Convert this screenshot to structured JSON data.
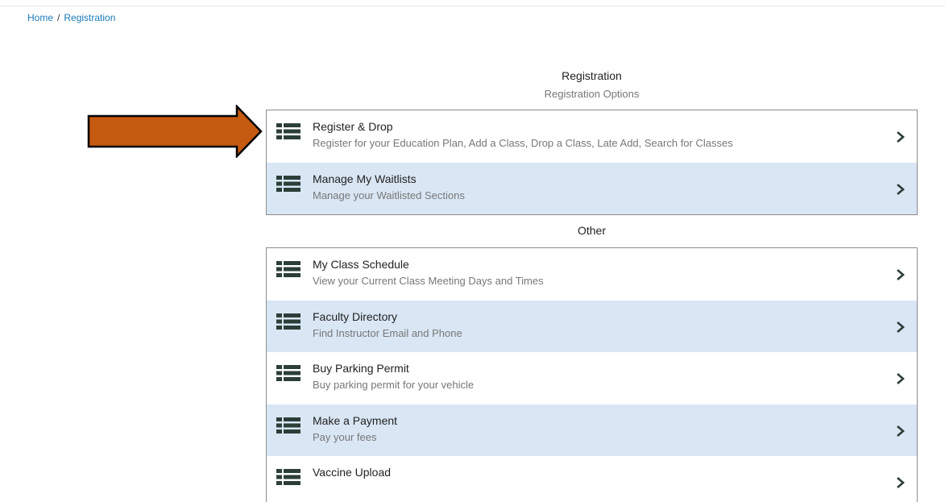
{
  "breadcrumb": {
    "home": "Home",
    "separator": "/",
    "current": "Registration"
  },
  "registration": {
    "title": "Registration",
    "subtitle": "Registration Options",
    "items": [
      {
        "label": "Register & Drop",
        "desc": "Register for your Education Plan, Add a Class, Drop a Class, Late Add, Search for Classes"
      },
      {
        "label": "Manage My Waitlists",
        "desc": "Manage your Waitlisted Sections"
      }
    ]
  },
  "other": {
    "title": "Other",
    "items": [
      {
        "label": "My Class Schedule",
        "desc": "View your Current Class Meeting Days and Times"
      },
      {
        "label": "Faculty Directory",
        "desc": "Find Instructor Email and Phone"
      },
      {
        "label": "Buy Parking Permit",
        "desc": "Buy parking permit for your vehicle"
      },
      {
        "label": "Make a Payment",
        "desc": "Pay your fees"
      },
      {
        "label": "Vaccine Upload",
        "desc": ""
      }
    ]
  },
  "icons": {
    "item_icon": "list-icon",
    "chevron": "chevron-right-icon",
    "annotation": "arrow-annotation-icon"
  },
  "colors": {
    "link": "#1a7ab8",
    "alt_row": "#d9e6f4",
    "icon": "#2c3e38",
    "arrow_fill": "#c55a11"
  }
}
